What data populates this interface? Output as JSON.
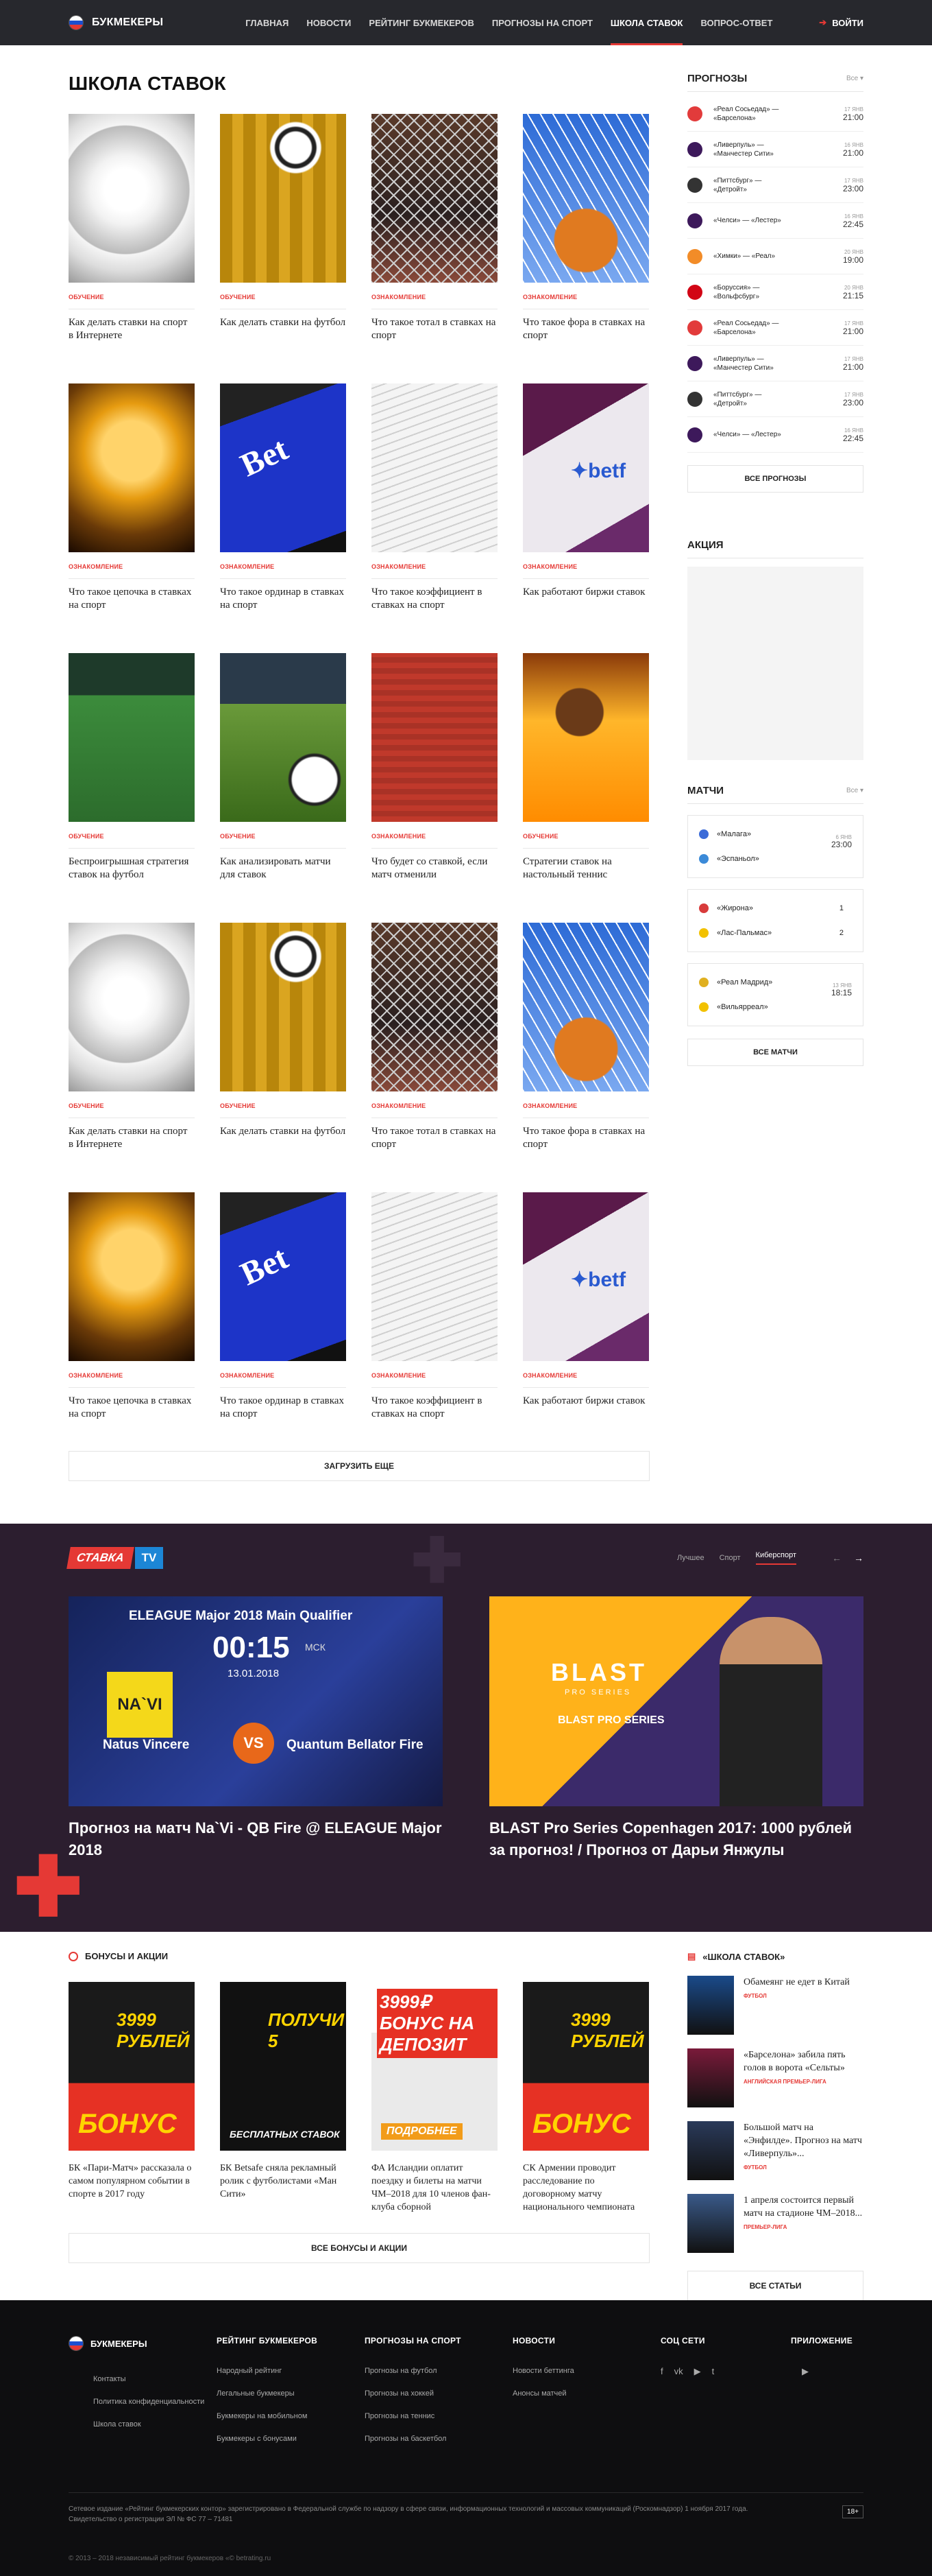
{
  "header": {
    "brand": "БУКМЕКЕРЫ",
    "nav": [
      "ГЛАВНАЯ",
      "НОВОСТИ",
      "РЕЙТИНГ БУКМЕКЕРОВ",
      "ПРОГНОЗЫ НА СПОРТ",
      "ШКОЛА СТАВОК",
      "ВОПРОС-ОТВЕТ"
    ],
    "active_nav": "ШКОЛА СТАВОК",
    "login": "ВОЙТИ"
  },
  "main": {
    "title": "ШКОЛА СТАВОК",
    "cards": [
      {
        "tag": "ОБУЧЕНИЕ",
        "title": "Как делать ставки на спорт в Интернете",
        "thumb": "soccer-ball"
      },
      {
        "tag": "ОБУЧЕНИЕ",
        "title": "Как делать ставки на футбол",
        "thumb": "coins-ball"
      },
      {
        "tag": "ОЗНАКОМЛЕНИЕ",
        "title": "Что такое тотал в ставках на спорт",
        "thumb": "goal-net"
      },
      {
        "tag": "ОЗНАКОМЛЕНИЕ",
        "title": "Что такое фора в ставках на спорт",
        "thumb": "basketball-hoop"
      },
      {
        "tag": "ОЗНАКОМЛЕНИЕ",
        "title": "Что такое цепочка в ставках на спорт",
        "thumb": "golden-ball"
      },
      {
        "tag": "ОЗНАКОМЛЕНИЕ",
        "title": "Что такое ординар в ставках на спорт",
        "thumb": "bet-key"
      },
      {
        "tag": "ОЗНАКОМЛЕНИЕ",
        "title": "Что такое коэффициент в ставках на спорт",
        "thumb": "bet-ticket"
      },
      {
        "tag": "ОЗНАКОМЛЕНИЕ",
        "title": "Как работают биржи ставок",
        "thumb": "betfair"
      },
      {
        "tag": "ОБУЧЕНИЕ",
        "title": "Беспроигрышная стратегия ставок на футбол",
        "thumb": "pitch-players"
      },
      {
        "tag": "ОБУЧЕНИЕ",
        "title": "Как анализировать матчи для ставок",
        "thumb": "pitch-ball"
      },
      {
        "tag": "ОЗНАКОМЛЕНИЕ",
        "title": "Что будет со ставкой, если матч отменили",
        "thumb": "stadium-rain"
      },
      {
        "tag": "ОБУЧЕНИЕ",
        "title": "Стратегии ставок на настольный теннис",
        "thumb": "table-tennis"
      },
      {
        "tag": "ОБУЧЕНИЕ",
        "title": "Как делать ставки на спорт в Интернете",
        "thumb": "soccer-ball"
      },
      {
        "tag": "ОБУЧЕНИЕ",
        "title": "Как делать ставки на футбол",
        "thumb": "coins-ball"
      },
      {
        "tag": "ОЗНАКОМЛЕНИЕ",
        "title": "Что такое тотал в ставках на спорт",
        "thumb": "goal-net"
      },
      {
        "tag": "ОЗНАКОМЛЕНИЕ",
        "title": "Что такое фора в ставках на спорт",
        "thumb": "basketball-hoop"
      },
      {
        "tag": "ОЗНАКОМЛЕНИЕ",
        "title": "Что такое цепочка в ставках на спорт",
        "thumb": "golden-ball"
      },
      {
        "tag": "ОЗНАКОМЛЕНИЕ",
        "title": "Что такое ординар в ставках на спорт",
        "thumb": "bet-key"
      },
      {
        "tag": "ОЗНАКОМЛЕНИЕ",
        "title": "Что такое коэффициент в ставках на спорт",
        "thumb": "bet-ticket"
      },
      {
        "tag": "ОЗНАКОМЛЕНИЕ",
        "title": "Как работают биржи ставок",
        "thumb": "betfair"
      }
    ],
    "load_more": "ЗАГРУЗИТЬ ЕЩЕ"
  },
  "sidebar": {
    "forecasts_title": "ПРОГНОЗЫ",
    "forecasts_filter": "Все",
    "forecasts": [
      {
        "home": "«Реал Сосьедад» —",
        "away": "«Барселона»",
        "date": "17 ЯНВ",
        "time": "21:00",
        "icon_color": "#e23b3b"
      },
      {
        "home": "«Ливерпуль» —",
        "away": "«Манчестер Сити»",
        "date": "16 ЯНВ",
        "time": "21:00",
        "icon_color": "#3d195b"
      },
      {
        "home": "«Питтсбург» —",
        "away": "«Детройт»",
        "date": "17 ЯНВ",
        "time": "23:00",
        "icon_color": "#333333"
      },
      {
        "home": "«Челси» — «Лестер»",
        "away": "",
        "date": "16 ЯНВ",
        "time": "22:45",
        "icon_color": "#3d195b"
      },
      {
        "home": "«Химки» — «Реал»",
        "away": "",
        "date": "20 ЯНВ",
        "time": "19:00",
        "icon_color": "#f28c28"
      },
      {
        "home": "«Боруссия» —",
        "away": "«Вольфсбург»",
        "date": "20 ЯНВ",
        "time": "21:15",
        "icon_color": "#d20515"
      },
      {
        "home": "«Реал Сосьедад» —",
        "away": "«Барселона»",
        "date": "17 ЯНВ",
        "time": "21:00",
        "icon_color": "#e23b3b"
      },
      {
        "home": "«Ливерпуль» —",
        "away": "«Манчестер Сити»",
        "date": "17 ЯНВ",
        "time": "21:00",
        "icon_color": "#3d195b"
      },
      {
        "home": "«Питтсбург» —",
        "away": "«Детройт»",
        "date": "17 ЯНВ",
        "time": "23:00",
        "icon_color": "#333333"
      },
      {
        "home": "«Челси» — «Лестер»",
        "away": "",
        "date": "16 ЯНВ",
        "time": "22:45",
        "icon_color": "#3d195b"
      }
    ],
    "forecasts_button": "ВСЕ ПРОГНОЗЫ",
    "promo_title": "АКЦИЯ",
    "matches_title": "МАТЧИ",
    "matches_filter": "Все",
    "matches": [
      {
        "home": "«Малага»",
        "away": "«Эспаньол»",
        "home_score": "",
        "away_score": "",
        "date": "6 ЯНВ",
        "time": "23:00",
        "home_color": "#3b6bd8",
        "away_color": "#3b8ad8"
      },
      {
        "home": "«Жирона»",
        "away": "«Лас-Пальмас»",
        "home_score": "1",
        "away_score": "2",
        "date": "",
        "time": "",
        "home_color": "#d83b3b",
        "away_color": "#f2c100"
      },
      {
        "home": "«Реал Мадрид»",
        "away": "«Вильярреал»",
        "home_score": "",
        "away_score": "",
        "date": "13 ЯНВ",
        "time": "18:15",
        "home_color": "#e0b020",
        "away_color": "#f2c100"
      }
    ],
    "matches_button": "ВСЕ МАТЧИ"
  },
  "tv": {
    "logo_a": "СТАВКА",
    "logo_b": "TV",
    "tabs": [
      "Лучшее",
      "Спорт",
      "Киберспорт"
    ],
    "active_tab": "Киберспорт",
    "arrow_prev": "←",
    "arrow_next": "→",
    "video1": {
      "headline": "ELEAGUE Major 2018 Main Qualifier",
      "time": "00:15",
      "tz": "МСК",
      "date": "13.01.2018",
      "team_a": "Natus Vincere",
      "team_b": "Quantum Bellator Fire",
      "vs": "VS",
      "logo_a": "NA`VI",
      "title": "Прогноз на матч Na`Vi - QB Fire @ ELEAGUE Major 2018"
    },
    "video2": {
      "brand": "BLAST",
      "series": "PRO SERIES",
      "subtitle": "BLAST PRO SERIES",
      "title": "BLAST Pro Series Copenhagen 2017: 1000 рублей за прогноз! / Прогноз от Дарьи Янжулы"
    }
  },
  "bonuses": {
    "title": "БОНУСЫ И АКЦИИ",
    "items": [
      {
        "text": "БК «Пари-Матч» рассказала о самом популярном событии в спорте в 2017 году",
        "badge": "3999 РУБЛЕЙ",
        "sub": "БОНУС"
      },
      {
        "text": "БК Betsafe сняла рекламный ролик с футболистами «Ман Сити»",
        "badge": "ПОЛУЧИ 5",
        "sub": "БЕСПЛАТНЫХ СТАВОК"
      },
      {
        "text": "ФА Исландии оплатит поездку и билеты на матчи ЧМ–2018 для 10 членов фан-клуба сборной",
        "badge": "3999₽ БОНУС НА ДЕПОЗИТ",
        "sub": "ПОДРОБНЕЕ"
      },
      {
        "text": "СК Армении проводит расследование по договорному матчу национального чемпионата",
        "badge": "3999 РУБЛЕЙ",
        "sub": "БОНУС"
      }
    ],
    "button": "ВСЕ БОНУСЫ И АКЦИИ"
  },
  "school": {
    "title": "«ШКОЛА СТАВОК»",
    "articles": [
      {
        "title": "Обамеянг не едет в Китай",
        "cat": "ФУТБОЛ"
      },
      {
        "title": "«Барселона» забила пять голов в ворота «Сельты»",
        "cat": "АНГЛИЙСКАЯ ПРЕМЬЕР-ЛИГА"
      },
      {
        "title": "Большой матч на «Энфилде». Прогноз на матч «Ливерпуль»...",
        "cat": "ФУТБОЛ"
      },
      {
        "title": "1 апреля состоится первый матч на стадионе ЧМ–2018...",
        "cat": "ПРЕМЬЕР-ЛИГА"
      }
    ],
    "button": "ВСЕ СТАТЬИ"
  },
  "footer": {
    "brand": "БУКМЕКЕРЫ",
    "col1": [
      "Контакты",
      "Политика конфиденциальности",
      "Школа ставок"
    ],
    "col2_title": "РЕЙТИНГ БУКМЕКЕРОВ",
    "col2": [
      "Народный рейтинг",
      "Легальные букмекеры",
      "Букмекеры на мобильном",
      "Букмекеры с бонусами"
    ],
    "col3_title": "ПРОГНОЗЫ НА СПОРТ",
    "col3": [
      "Прогнозы на футбол",
      "Прогнозы на хоккей",
      "Прогнозы на теннис",
      "Прогнозы на баскетбол"
    ],
    "col4_title": "НОВОСТИ",
    "col4": [
      "Новости беттинга",
      "Анонсы матчей"
    ],
    "col5_title": "СОЦ СЕТИ",
    "social": [
      "f",
      "vk",
      "▶",
      "t"
    ],
    "col6_title": "ПРИЛОЖЕНИЕ",
    "apps": [
      "",
      "▶"
    ],
    "legal": "Сетевое издание «Рейтинг букмекерских контор» зарегистрировано в Федеральной службе по надзору в сфере связи, информационных технологий и массовых коммуникаций (Роскомнадзор) 1 ноября 2017 года. Свидетельство о регистрации ЭЛ № ФС 77 – 71481",
    "age": "18+",
    "copyright": "© 2013 – 2018 независимый рейтинг букмекеров «© betrating.ru"
  }
}
